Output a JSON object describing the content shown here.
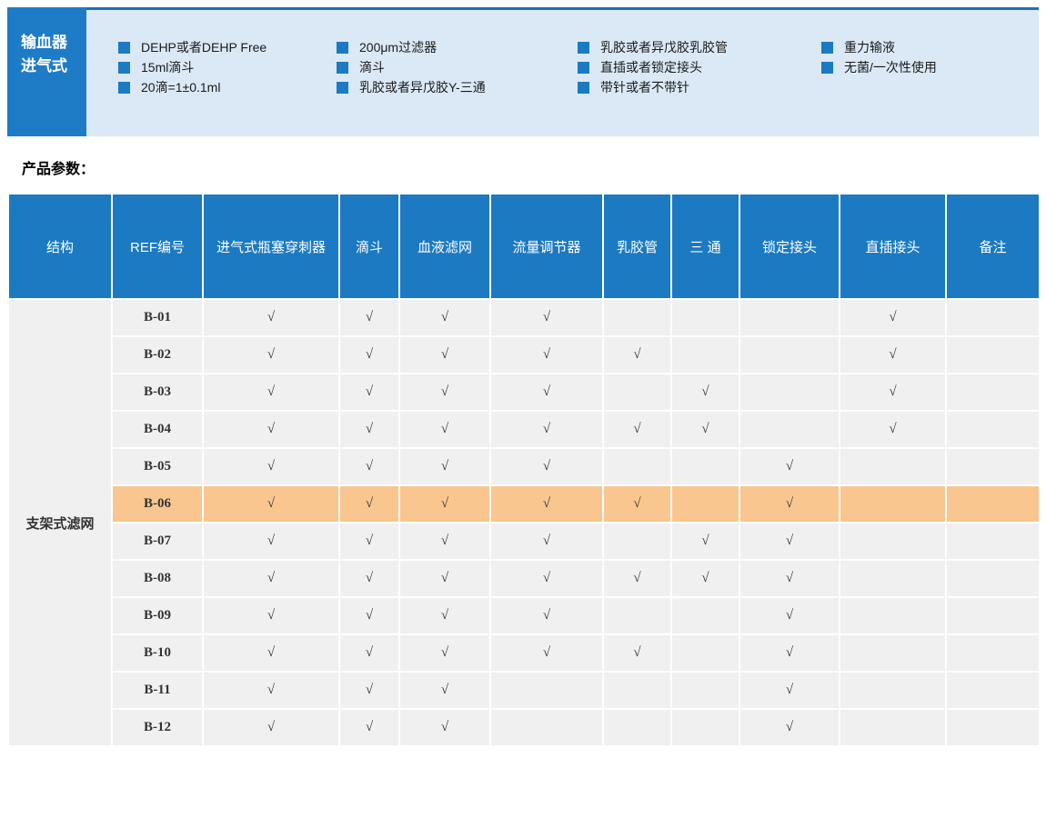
{
  "banner": {
    "title_lines": [
      "输血器",
      "进气式"
    ],
    "feature_columns": [
      {
        "items": [
          "DEHP或者DEHP Free",
          "15ml滴斗",
          "20滴=1±0.1ml"
        ]
      },
      {
        "items": [
          "200μm过滤器",
          "滴斗",
          "乳胶或者异戊胶Y-三通"
        ]
      },
      {
        "items": [
          "乳胶或者异戊胶乳胶管",
          "直插或者锁定接头",
          "带针或者不带针"
        ]
      },
      {
        "items": [
          "重力输液",
          "无菌/一次性使用"
        ]
      }
    ]
  },
  "section_label": "产品参数：",
  "table": {
    "columns": [
      "结构",
      "REF编号",
      "进气式瓶塞穿刺器",
      "滴斗",
      "血液滤网",
      "流量调节器",
      "乳胶管",
      "三 通",
      "锁定接头",
      "直插接头",
      "备注"
    ],
    "structure_label": "支架式滤网",
    "check_glyph": "√",
    "highlighted_ref": "B-06",
    "rows": [
      {
        "ref": "B-01",
        "checks": [
          1,
          1,
          1,
          1,
          0,
          0,
          0,
          1
        ],
        "remark": ""
      },
      {
        "ref": "B-02",
        "checks": [
          1,
          1,
          1,
          1,
          1,
          0,
          0,
          1
        ],
        "remark": ""
      },
      {
        "ref": "B-03",
        "checks": [
          1,
          1,
          1,
          1,
          0,
          1,
          0,
          1
        ],
        "remark": ""
      },
      {
        "ref": "B-04",
        "checks": [
          1,
          1,
          1,
          1,
          1,
          1,
          0,
          1
        ],
        "remark": ""
      },
      {
        "ref": "B-05",
        "checks": [
          1,
          1,
          1,
          1,
          0,
          0,
          1,
          0
        ],
        "remark": ""
      },
      {
        "ref": "B-06",
        "checks": [
          1,
          1,
          1,
          1,
          1,
          0,
          1,
          0
        ],
        "remark": ""
      },
      {
        "ref": "B-07",
        "checks": [
          1,
          1,
          1,
          1,
          0,
          1,
          1,
          0
        ],
        "remark": ""
      },
      {
        "ref": "B-08",
        "checks": [
          1,
          1,
          1,
          1,
          1,
          1,
          1,
          0
        ],
        "remark": ""
      },
      {
        "ref": "B-09",
        "checks": [
          1,
          1,
          1,
          1,
          0,
          0,
          1,
          0
        ],
        "remark": ""
      },
      {
        "ref": "B-10",
        "checks": [
          1,
          1,
          1,
          1,
          1,
          0,
          1,
          0
        ],
        "remark": ""
      },
      {
        "ref": "B-11",
        "checks": [
          1,
          1,
          1,
          0,
          0,
          0,
          1,
          0
        ],
        "remark": ""
      },
      {
        "ref": "B-12",
        "checks": [
          1,
          1,
          1,
          0,
          0,
          0,
          1,
          0
        ],
        "remark": ""
      }
    ]
  },
  "colors": {
    "header_blue": "#1b7ac1",
    "title_box_blue": "#1e7cc7",
    "banner_light_blue": "#dbe9f6",
    "banner_top_border": "#1a70b8",
    "row_grey": "#f0f0f1",
    "highlight_orange": "#f9c690"
  }
}
